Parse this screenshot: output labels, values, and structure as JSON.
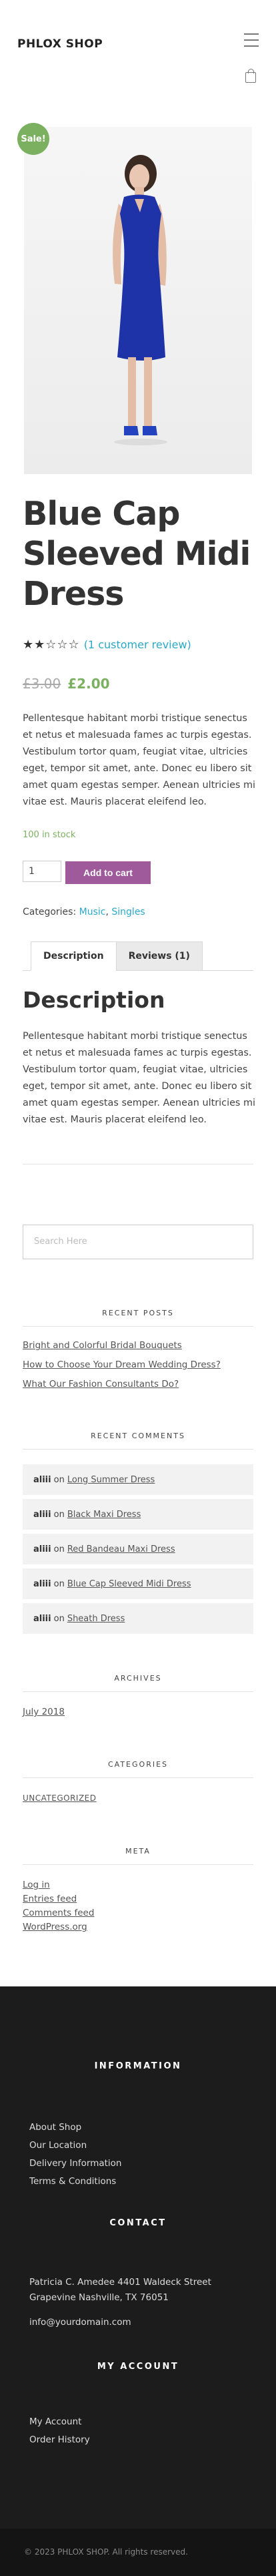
{
  "header": {
    "logo": "PHLOX SHOP"
  },
  "product": {
    "sale_badge": "Sale!",
    "title_line1": "Blue Cap",
    "title_line2": "Sleeved Midi",
    "title_line3": "Dress",
    "rating_stars": 2,
    "rating_text": "(1 customer review)",
    "old_price": "£3.00",
    "new_price": "£2.00",
    "short_description": "Pellentesque habitant morbi tristique senectus et netus et malesuada fames ac turpis egestas. Vestibulum tortor quam, feugiat vitae, ultricies eget, tempor sit amet, ante. Donec eu libero sit amet quam egestas semper. Aenean ultricies mi vitae est. Mauris placerat eleifend leo.",
    "stock": "100 in stock",
    "quantity": "1",
    "add_to_cart": "Add to cart",
    "categories_label": "Categories:",
    "category1": "Music",
    "category_sep": ",",
    "category2": "Singles"
  },
  "tabs": {
    "description": "Description",
    "reviews": "Reviews (1)"
  },
  "description": {
    "heading": "Description",
    "body": "Pellentesque habitant morbi tristique senectus et netus et malesuada fames ac turpis egestas. Vestibulum tortor quam, feugiat vitae, ultricies eget, tempor sit amet, ante. Donec eu libero sit amet quam egestas semper. Aenean ultricies mi vitae est. Mauris placerat eleifend leo."
  },
  "sidebar": {
    "search_placeholder": "Search Here",
    "recent_posts_title": "RECENT POSTS",
    "recent_posts": [
      "Bright and Colorful Bridal Bouquets",
      "How to Choose Your Dream Wedding Dress?",
      "What Our Fashion Consultants Do?"
    ],
    "recent_comments_title": "RECENT COMMENTS",
    "comment_author": "aliii",
    "comment_on": "on",
    "recent_comments": [
      "Long Summer Dress",
      "Black Maxi Dress",
      "Red Bandeau Maxi Dress",
      "Blue Cap Sleeved Midi Dress",
      "Sheath Dress"
    ],
    "archives_title": "ARCHIVES",
    "archives": [
      "July 2018"
    ],
    "categories_title": "CATEGORIES",
    "categories": [
      "UNCATEGORIZED"
    ],
    "meta_title": "META",
    "meta": [
      "Log in",
      "Entries feed",
      "Comments feed",
      "WordPress.org"
    ]
  },
  "footer": {
    "information_title": "INFORMATION",
    "information": [
      "About Shop",
      "Our Location",
      "Delivery Information",
      "Terms & Conditions"
    ],
    "contact_title": "CONTACT",
    "address_line1": "Patricia C. Amedee 4401 Waldeck Street",
    "address_line2": "Grapevine Nashville, TX 76051",
    "email": "info@yourdomain.com",
    "account_title": "MY ACCOUNT",
    "account": [
      "My Account",
      "Order History"
    ],
    "copyright": "© 2023 PHLOX SHOP. All rights reserved."
  },
  "colors": {
    "accent_green": "#7cb061",
    "link_blue": "#2aa9c8",
    "button_purple": "#9e5a9a",
    "footer_bg": "#1c1c1c",
    "dress_blue": "#1f33a8"
  }
}
